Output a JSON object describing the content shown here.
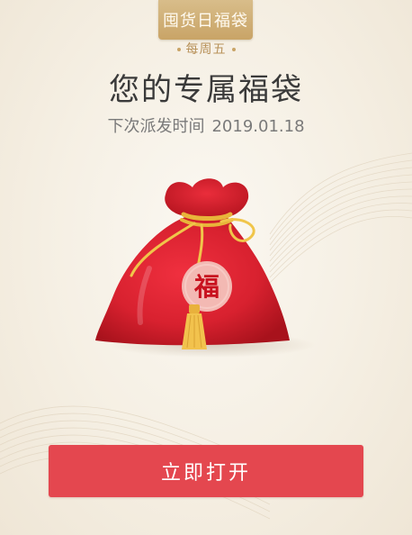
{
  "header": {
    "tab_label": "囤货日福袋",
    "weekday": "每周五"
  },
  "main": {
    "title": "您的专属福袋",
    "next_time_label": "下次派发时间",
    "next_time_value": "2019.01.18",
    "bag_char": "福"
  },
  "actions": {
    "open_label": "立即打开"
  },
  "colors": {
    "accent_red": "#e4474f",
    "gold": "#c9a467",
    "bag_red": "#d8212f"
  },
  "icons": {
    "bag": "lucky-bag-icon"
  }
}
